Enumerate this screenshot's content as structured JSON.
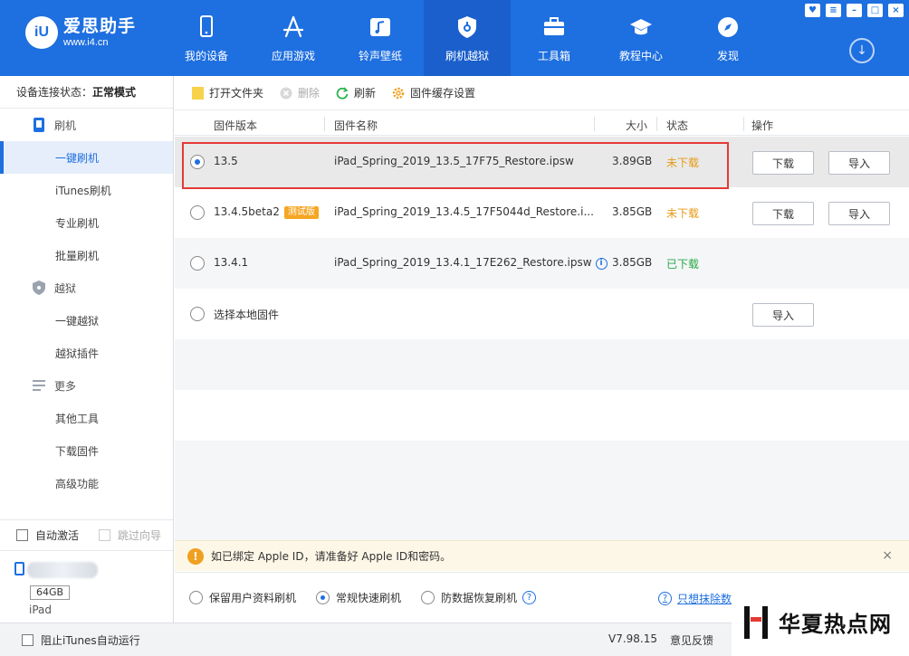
{
  "app": {
    "brand_title": "爱思助手",
    "brand_url": "www.i4.cn",
    "logo_mark": "iU"
  },
  "nav": [
    {
      "label": "我的设备",
      "icon": "phone-icon"
    },
    {
      "label": "应用游戏",
      "icon": "app-store-icon"
    },
    {
      "label": "铃声壁纸",
      "icon": "music-icon"
    },
    {
      "label": "刷机越狱",
      "icon": "shield-icon",
      "active": true
    },
    {
      "label": "工具箱",
      "icon": "toolbox-icon"
    },
    {
      "label": "教程中心",
      "icon": "graduation-cap-icon"
    },
    {
      "label": "发现",
      "icon": "compass-icon"
    }
  ],
  "sidebar": {
    "conn_label": "设备连接状态：",
    "conn_value": "正常模式",
    "groups": [
      {
        "label": "刷机",
        "icon": "flash-phone-icon",
        "items": [
          "一键刷机",
          "iTunes刷机",
          "专业刷机",
          "批量刷机"
        ]
      },
      {
        "label": "越狱",
        "icon": "jailbreak-shield-icon",
        "items": [
          "一键越狱",
          "越狱插件"
        ]
      },
      {
        "label": "更多",
        "icon": "more-menu-icon",
        "items": [
          "其他工具",
          "下载固件",
          "高级功能"
        ]
      }
    ],
    "active_item": "一键刷机",
    "auto_activate": "自动激活",
    "skip_wizard": "跳过向导",
    "device_storage": "64GB",
    "device_type": "iPad"
  },
  "toolbar": {
    "open_folder": "打开文件夹",
    "delete": "删除",
    "refresh": "刷新",
    "cache_settings": "固件缓存设置"
  },
  "table": {
    "headers": {
      "version": "固件版本",
      "name": "固件名称",
      "size": "大小",
      "status": "状态",
      "action": "操作"
    },
    "rows": [
      {
        "version": "13.5",
        "name": "iPad_Spring_2019_13.5_17F75_Restore.ipsw",
        "size": "3.89GB",
        "status": "未下载",
        "download": "下载",
        "import": "导入",
        "selected": true
      },
      {
        "version": "13.4.5beta2",
        "badge": "测试版",
        "name": "iPad_Spring_2019_13.4.5_17F5044d_Restore.i...",
        "size": "3.85GB",
        "status": "未下载",
        "download": "下载",
        "import": "导入"
      },
      {
        "version": "13.4.1",
        "name": "iPad_Spring_2019_13.4.1_17E262_Restore.ipsw",
        "size": "3.85GB",
        "status": "已下载"
      },
      {
        "version": "选择本地固件",
        "import": "导入"
      }
    ]
  },
  "notice": {
    "text": "如已绑定 Apple ID，请准备好 Apple ID和密码。",
    "close": "×"
  },
  "modes": {
    "keep_data": "保留用户资料刷机",
    "normal_fast": "常规快速刷机",
    "anti_recovery": "防数据恢复刷机",
    "erase_only": "只想抹除数"
  },
  "statusbar": {
    "block_itunes": "阻止iTunes自动运行",
    "version": "V7.98.15",
    "feedback": "意见反馈"
  },
  "watermark": {
    "text": "华夏热点网"
  },
  "colors": {
    "brand": "#1e6fe0",
    "not_downloaded": "#e69a16",
    "downloaded": "#26a846",
    "highlight": "#e53935"
  }
}
